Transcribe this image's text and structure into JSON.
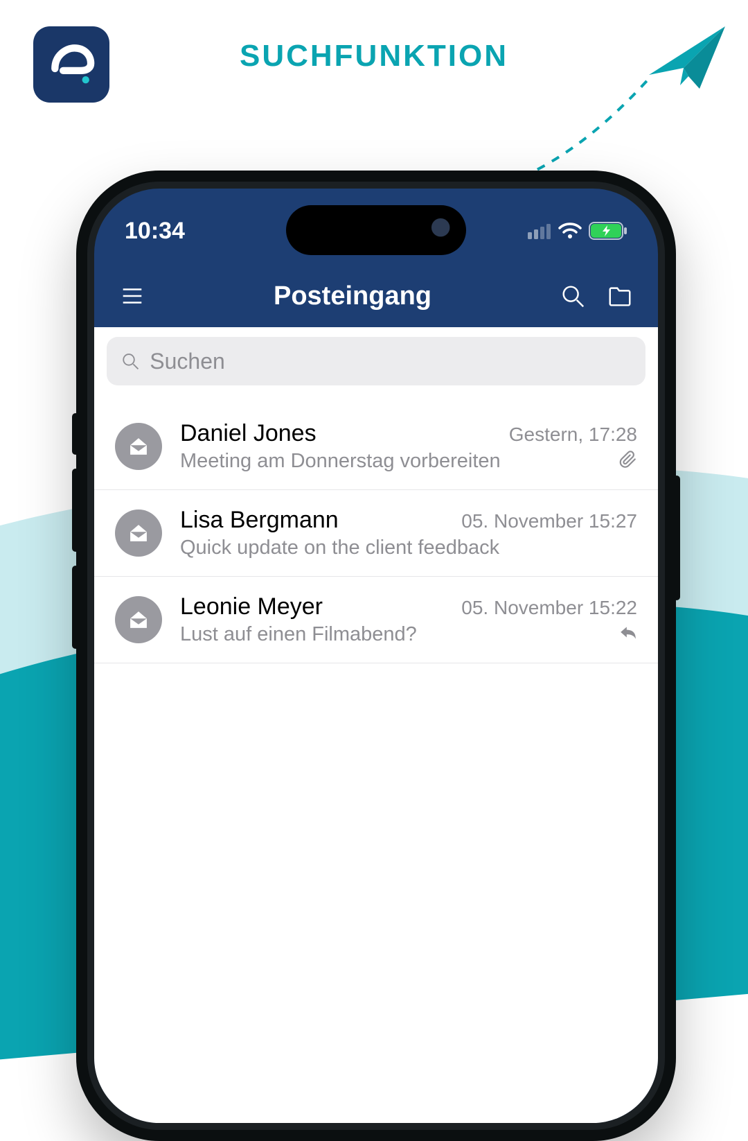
{
  "heading": "SUCHFUNKTION",
  "colors": {
    "brand_dark_blue": "#1a3768",
    "accent_teal": "#0aa4b1",
    "light_teal": "#c9ebef"
  },
  "status_bar": {
    "time": "10:34"
  },
  "navbar": {
    "title": "Posteingang"
  },
  "search": {
    "placeholder": "Suchen"
  },
  "mails": [
    {
      "sender": "Daniel Jones",
      "subject": "Meeting am Donnerstag vorbereiten",
      "time": "Gestern, 17:28",
      "indicator": "attachment"
    },
    {
      "sender": "Lisa Bergmann",
      "subject": "Quick update on the client feedback",
      "time": "05. November 15:27",
      "indicator": "none"
    },
    {
      "sender": "Leonie Meyer",
      "subject": "Lust auf einen Filmabend?",
      "time": "05. November 15:22",
      "indicator": "reply"
    }
  ]
}
